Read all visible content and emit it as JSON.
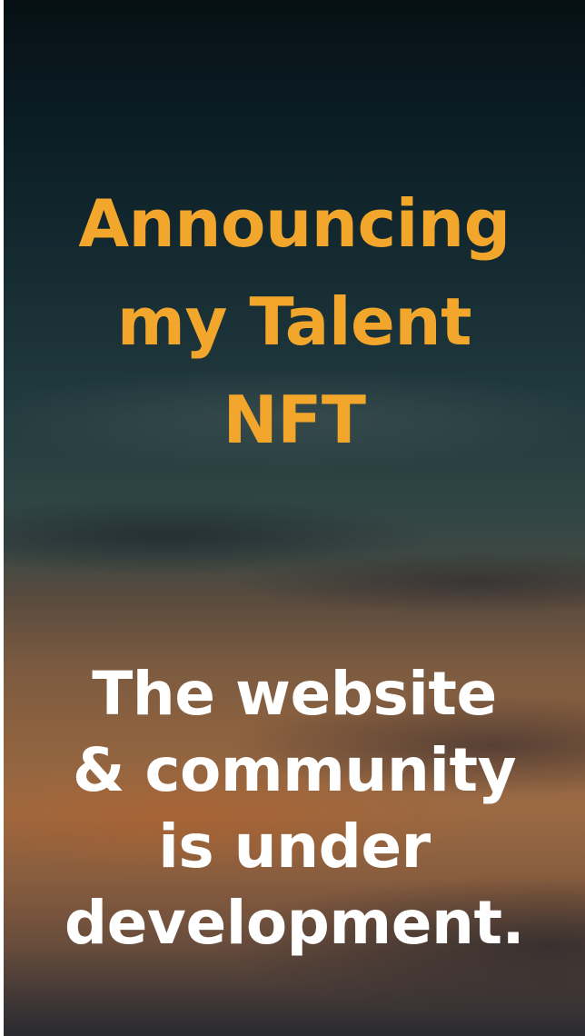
{
  "announcement": {
    "headline_lines": [
      "Announcing",
      "my Talent",
      "NFT"
    ],
    "message_lines": [
      "The website",
      "& community",
      "is under",
      "development."
    ]
  },
  "colors": {
    "headline": "#f2a62b",
    "message": "#ffffff",
    "sky_top": "#061014",
    "sky_sunset": "#9a6a44"
  }
}
